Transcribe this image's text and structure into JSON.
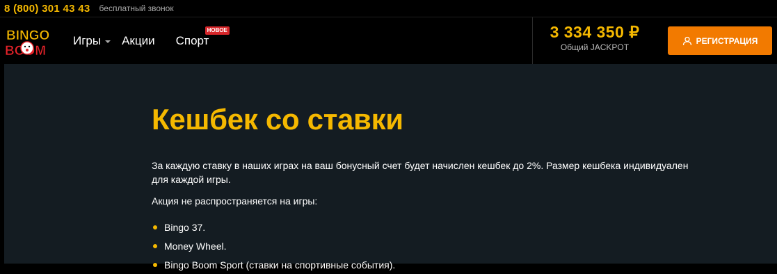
{
  "topbar": {
    "phone": "8 (800) 301 43 43",
    "free_call": "бесплатный звонок"
  },
  "logo": {
    "line1": "BINGO",
    "line2": "BOOM"
  },
  "nav": {
    "games": "Игры",
    "promo": "Акции",
    "sport": "Спорт",
    "sport_badge": "НОВОЕ"
  },
  "jackpot": {
    "value": "3 334 350 ₽",
    "label": "Общий JACKPOT"
  },
  "register": {
    "label": "РЕГИСТРАЦИЯ"
  },
  "article": {
    "title": "Кешбек со ставки",
    "paragraph": "За каждую ставку в наших играх на ваш бонусный счет будет начислен кешбек до 2%. Размер кешбека индивидуален для каждой игры.",
    "exclusion_intro": "Акция не распространяется на игры:",
    "excluded": [
      "Bingo 37.",
      "Money Wheel.",
      "Bingo Boom Sport (ставки на спортивные события)."
    ]
  },
  "colors": {
    "accent": "#f5b800",
    "button": "#f27a00",
    "badge": "#d7262a",
    "content_bg": "#141c22"
  }
}
